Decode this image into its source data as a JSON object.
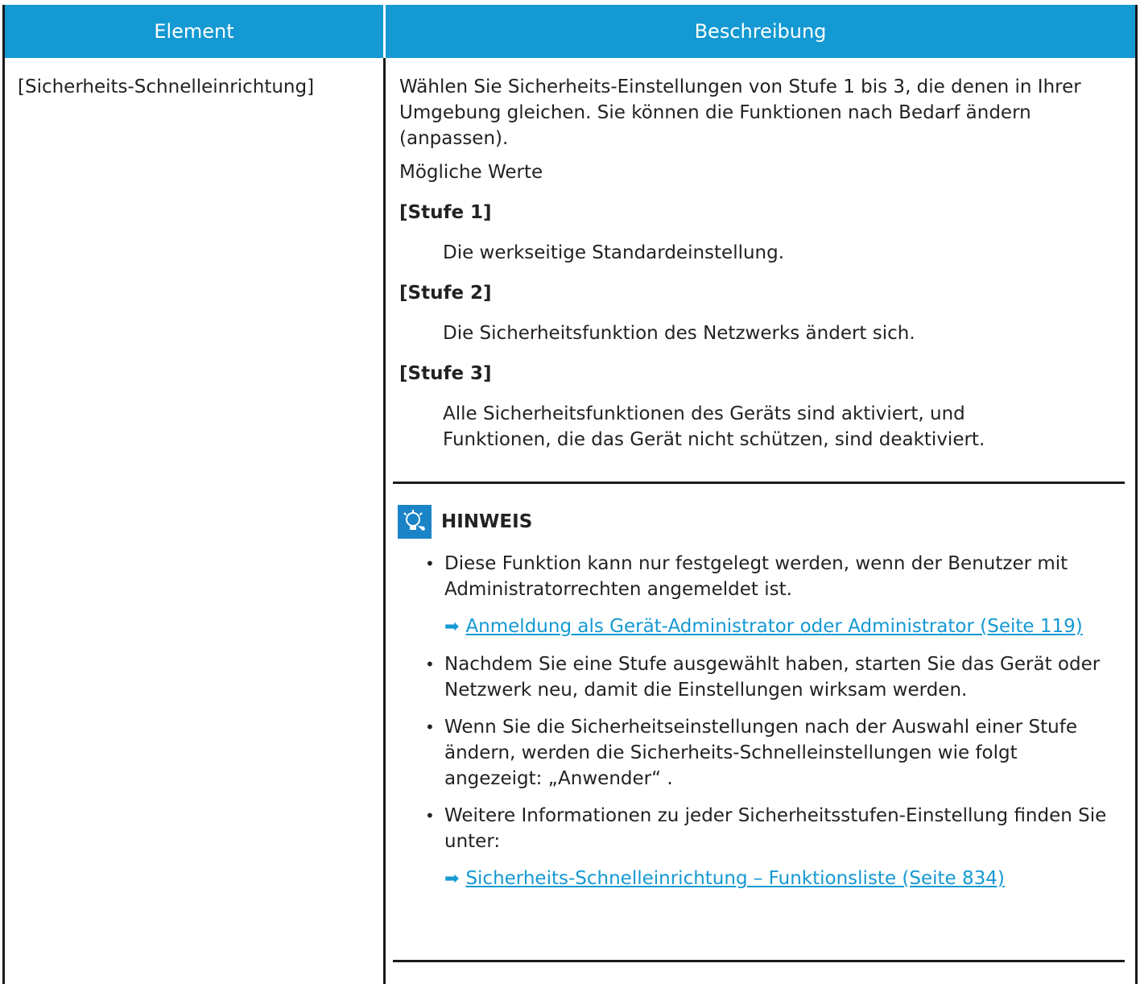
{
  "header": {
    "col1": "Element",
    "col2": "Beschreibung"
  },
  "row": {
    "element": "[Sicherheits-Schnelleinrichtung]",
    "intro": "Wählen Sie Sicherheits-Einstellungen von Stufe 1 bis 3, die denen in Ihrer Umgebung gleichen. Sie können die Funktionen nach Bedarf ändern (anpassen).",
    "values_label": "Mögliche Werte",
    "levels": [
      {
        "term": "[Stufe 1]",
        "desc": "Die werkseitige Standardeinstellung."
      },
      {
        "term": "[Stufe 2]",
        "desc": "Die Sicherheitsfunktion des Netzwerks ändert sich."
      },
      {
        "term": "[Stufe 3]",
        "desc": "Alle Sicherheitsfunktionen des Geräts sind aktiviert, und Funktionen, die das Gerät nicht schützen, sind deaktiviert."
      }
    ],
    "note": {
      "title": "HINWEIS",
      "bullets": [
        "Diese Funktion kann nur festgelegt werden, wenn der Benutzer mit Administratorrechten angemeldet ist.",
        "Nachdem Sie eine Stufe ausgewählt haben, starten Sie das Gerät oder Netzwerk neu, damit die Einstellungen wirksam werden.",
        "Wenn Sie die Sicherheitseinstellungen nach der Auswahl einer Stufe ändern, werden die Sicherheits-Schnelleinstellungen wie folgt angezeigt: „Anwender“ .",
        "Weitere Informationen zu jeder Sicherheitsstufen-Einstellung finden Sie unter:"
      ],
      "link1": "Anmeldung als Gerät-Administrator oder Administrator (Seite 119)",
      "link2": "Sicherheits-Schnelleinrichtung – Funktionsliste (Seite 834)"
    }
  },
  "colors": {
    "header_bg": "#1499d2",
    "link": "#1499d2",
    "icon_bg": "#1a84c7"
  },
  "icons": {
    "note": "lightbulb-icon",
    "link_arrow": "arrow-right-icon"
  }
}
